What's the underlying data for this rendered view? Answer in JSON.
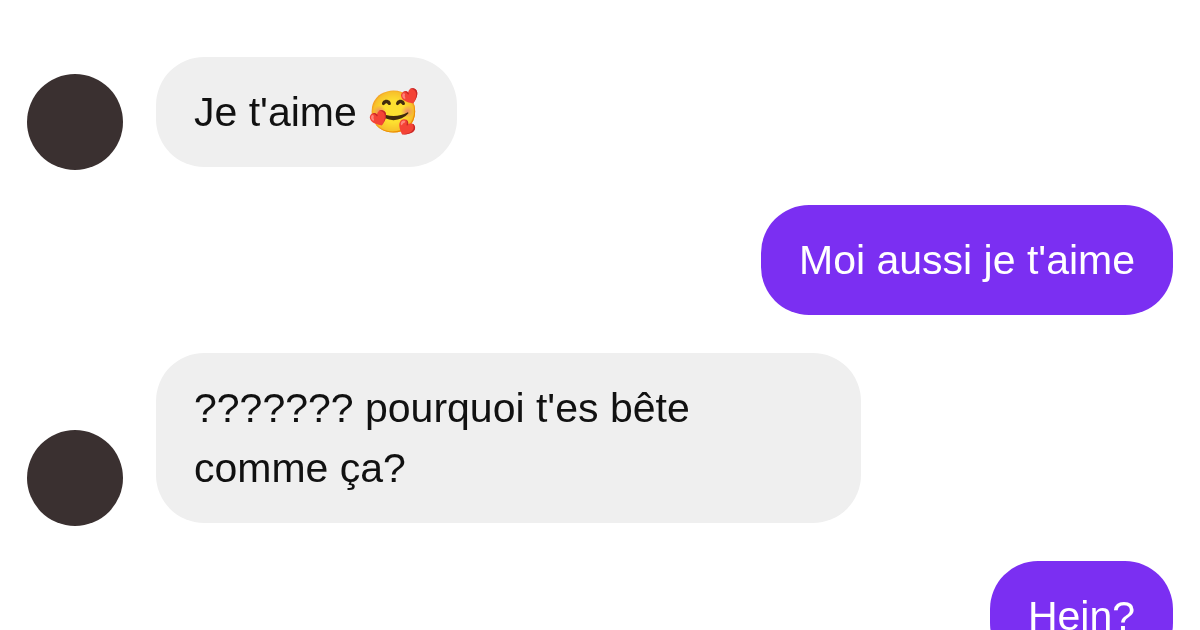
{
  "messages": [
    {
      "kind": "incoming",
      "text": "Je t'aime 🥰"
    },
    {
      "kind": "outgoing",
      "text": "Moi aussi je t'aime"
    },
    {
      "kind": "incoming",
      "text": "??????? pourquoi t'es bête comme ça?"
    },
    {
      "kind": "outgoing",
      "text": "Hein?"
    }
  ]
}
